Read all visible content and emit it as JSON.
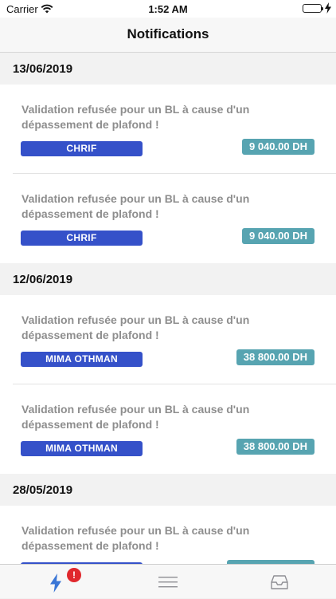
{
  "status_bar": {
    "carrier": "Carrier",
    "time": "1:52 AM",
    "battery_level": 1.0
  },
  "nav": {
    "title": "Notifications"
  },
  "sections": [
    {
      "date": "13/06/2019",
      "items": [
        {
          "message": "Validation refusée pour un BL à cause d'un dépassement de plafond !",
          "name": "CHRIF",
          "amount": "9 040.00 DH"
        },
        {
          "message": "Validation refusée pour un BL à cause d'un dépassement de plafond !",
          "name": "CHRIF",
          "amount": "9 040.00 DH"
        }
      ]
    },
    {
      "date": "12/06/2019",
      "items": [
        {
          "message": "Validation refusée pour un BL à cause d'un dépassement de plafond !",
          "name": "MIMA OTHMAN",
          "amount": "38 800.00 DH"
        },
        {
          "message": "Validation refusée pour un BL à cause d'un dépassement de plafond !",
          "name": "MIMA OTHMAN",
          "amount": "38 800.00 DH"
        }
      ]
    },
    {
      "date": "28/05/2019",
      "items": [
        {
          "message": "Validation refusée pour un BL à cause d'un dépassement de plafond !",
          "name": "",
          "amount": ""
        }
      ]
    }
  ],
  "tab_bar": {
    "tabs": [
      {
        "icon": "lightning-icon",
        "badge": "!",
        "selected": true
      },
      {
        "icon": "menu-icon",
        "selected": false
      },
      {
        "icon": "inbox-icon",
        "selected": false
      }
    ],
    "selected_color": "#3a76d6",
    "inactive_color": "#8e8e93"
  },
  "colors": {
    "name_badge": "#3551c9",
    "amount_badge": "#57a4b1",
    "alert": "#e0282d"
  }
}
